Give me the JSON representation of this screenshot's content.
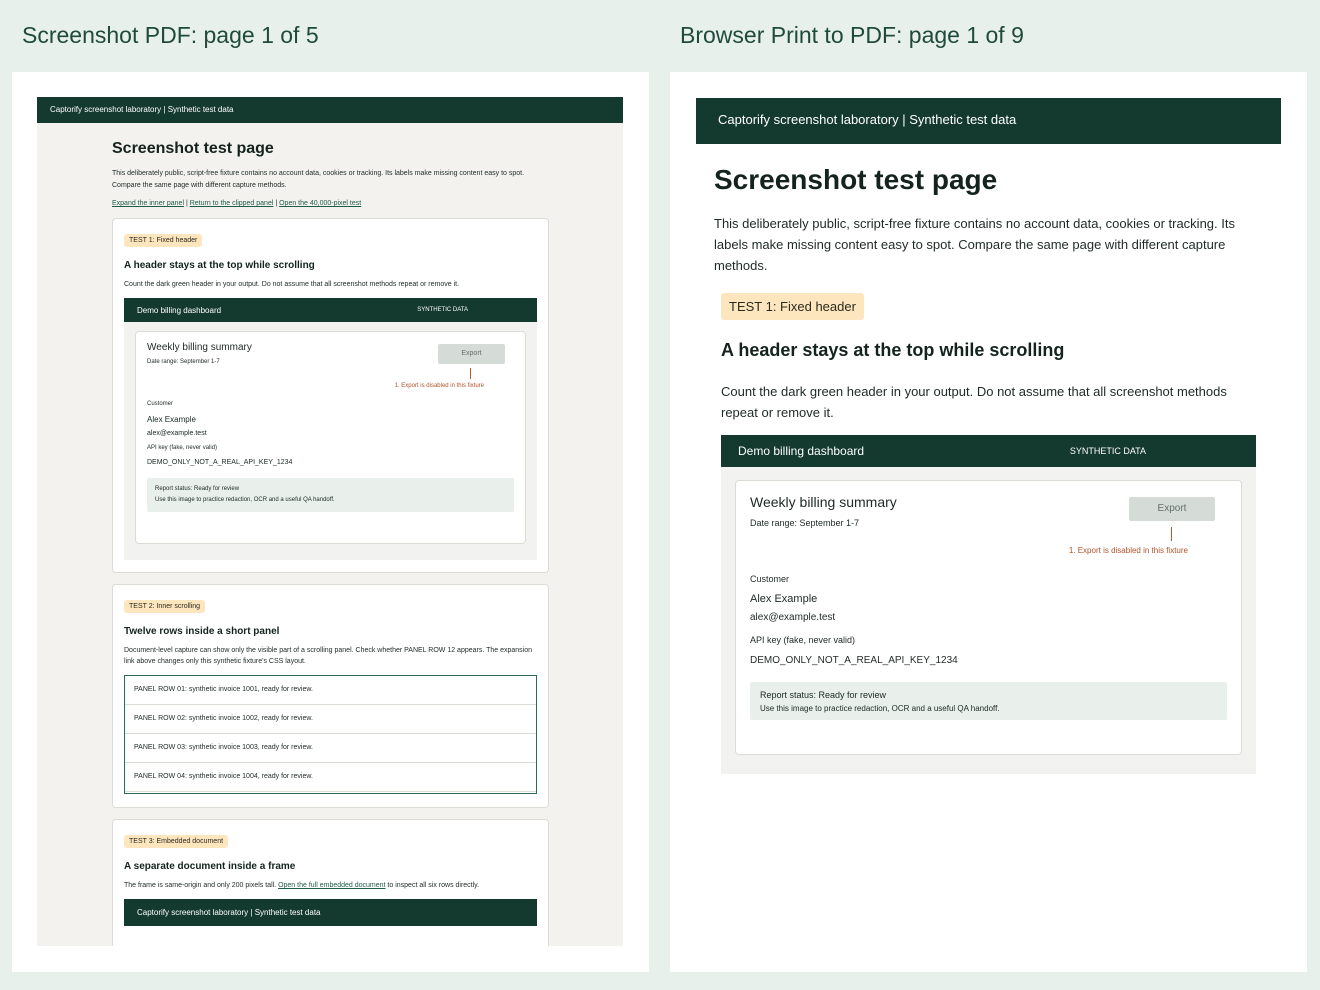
{
  "left": {
    "column_title": "Screenshot PDF: page 1 of 5",
    "site_header": "Captorify screenshot laboratory | Synthetic test data",
    "page_title": "Screenshot test page",
    "intro": "This deliberately public, script-free fixture contains no account data, cookies or tracking. Its labels make missing content easy to spot. Compare the same page with different capture methods.",
    "links": {
      "expand": "Expand the inner panel",
      "sep1": " | ",
      "return": "Return to the clipped panel",
      "sep2": " | ",
      "open": "Open the 40,000-pixel test"
    },
    "test1": {
      "badge": "TEST 1: Fixed header",
      "heading": "A header stays at the top while scrolling",
      "text": "Count the dark green header in your output. Do not assume that all screenshot methods repeat or remove it."
    },
    "test2": {
      "badge": "TEST 2: Inner scrolling",
      "heading": "Twelve rows inside a short panel",
      "text": "Document-level capture can show only the visible part of a scrolling panel. Check whether PANEL ROW 12 appears. The expansion link above changes only this synthetic fixture's CSS layout.",
      "rows": [
        "PANEL ROW 01: synthetic invoice 1001, ready for review.",
        "PANEL ROW 02: synthetic invoice 1002, ready for review.",
        "PANEL ROW 03: synthetic invoice 1003, ready for review.",
        "PANEL ROW 04: synthetic invoice 1004, ready for review."
      ]
    },
    "test3": {
      "badge": "TEST 3: Embedded document",
      "heading": "A separate document inside a frame",
      "text_before": "The frame is same-origin and only 200 pixels tall. ",
      "link": "Open the full embedded document",
      "text_after": " to inspect all six rows directly.",
      "frame_header": "Captorify screenshot laboratory | Synthetic test data"
    }
  },
  "right": {
    "column_title": "Browser Print to PDF: page 1 of 9",
    "site_header": "Captorify screenshot laboratory | Synthetic test data",
    "page_title": "Screenshot test page",
    "intro": "This deliberately public, script-free fixture contains no account data, cookies or tracking. Its labels make missing content easy to spot. Compare the same page with different capture methods.",
    "test1": {
      "badge": "TEST 1: Fixed header",
      "heading": "A header stays at the top while scrolling",
      "text": "Count the dark green header in your output. Do not assume that all screenshot methods repeat or remove it."
    }
  },
  "dashboard": {
    "title": "Demo billing dashboard",
    "tag": "SYNTHETIC DATA",
    "summary_title": "Weekly billing summary",
    "date_range": "Date range: September 1-7",
    "export_label": "Export",
    "callout": "1. Export is disabled in this fixture",
    "customer_label": "Customer",
    "customer_name": "Alex Example",
    "customer_email": "alex@example.test",
    "api_label": "API key (fake, never valid)",
    "api_value": "DEMO_ONLY_NOT_A_REAL_API_KEY_1234",
    "status": "Report status: Ready for review",
    "status_note": "Use this image to practice redaction, OCR and a useful QA handoff."
  },
  "colors": {
    "background": "#e8f0ec",
    "header_green": "#143a30",
    "badge": "#fde5bd",
    "callout": "#c0542b"
  }
}
